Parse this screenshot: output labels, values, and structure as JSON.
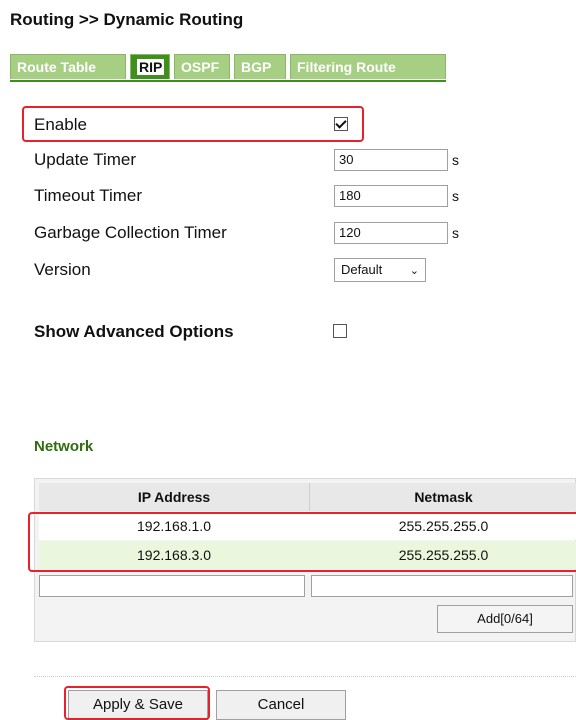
{
  "page": {
    "title": "Routing >> Dynamic Routing"
  },
  "tabs": [
    {
      "label": "Route Table",
      "active": false
    },
    {
      "label": "RIP",
      "active": true
    },
    {
      "label": "OSPF",
      "active": false
    },
    {
      "label": "BGP",
      "active": false
    },
    {
      "label": "Filtering Route",
      "active": false
    }
  ],
  "form": {
    "enable": {
      "label": "Enable",
      "checked": true
    },
    "update_timer": {
      "label": "Update Timer",
      "value": "30",
      "unit": "s"
    },
    "timeout_timer": {
      "label": "Timeout Timer",
      "value": "180",
      "unit": "s"
    },
    "garbage_timer": {
      "label": "Garbage Collection Timer",
      "value": "120",
      "unit": "s"
    },
    "version": {
      "label": "Version",
      "value": "Default"
    },
    "advanced": {
      "label": "Show Advanced Options",
      "checked": false
    }
  },
  "network": {
    "title": "Network",
    "columns": [
      "IP Address",
      "Netmask"
    ],
    "rows": [
      {
        "ip": "192.168.1.0",
        "mask": "255.255.255.0"
      },
      {
        "ip": "192.168.3.0",
        "mask": "255.255.255.0"
      }
    ],
    "add_label": "Add[0/64]"
  },
  "buttons": {
    "apply": "Apply & Save",
    "cancel": "Cancel"
  },
  "colors": {
    "tab_active": "#3f8f1e",
    "tab_inactive": "#a7cf83",
    "highlight": "#e8212b",
    "row_alt": "#eaf7dc"
  }
}
